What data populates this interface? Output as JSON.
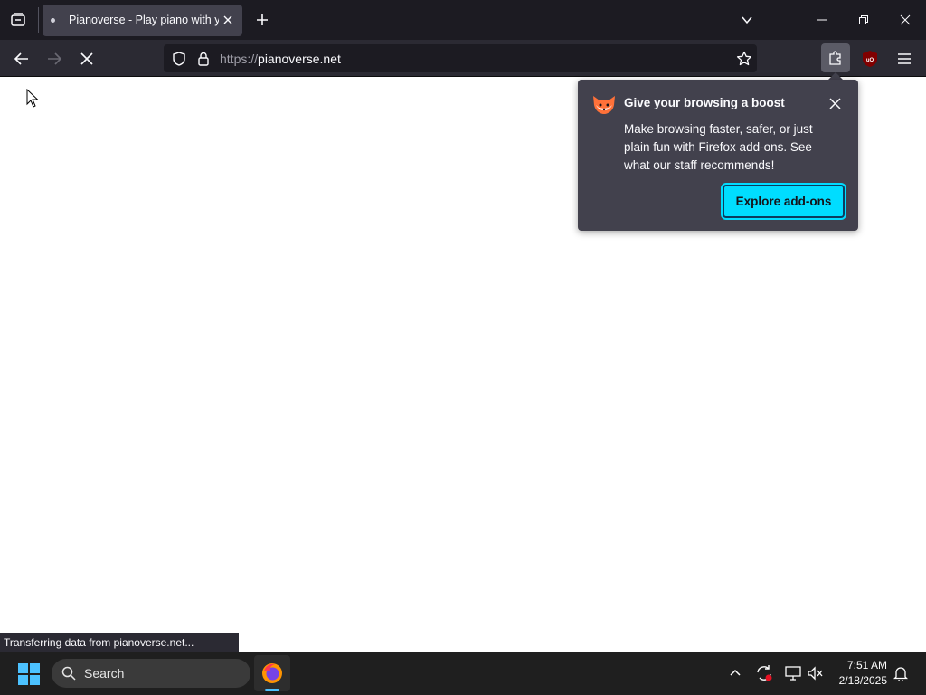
{
  "browser": {
    "tab": {
      "title": "Pianoverse - Play piano with yo"
    },
    "url": {
      "scheme": "https://",
      "host": "pianoverse.net"
    }
  },
  "popup": {
    "title": "Give your browsing a boost",
    "body": "Make browsing faster, safer, or just plain fun with Firefox add-ons. See what our staff recommends!",
    "button_label": "Explore add-ons"
  },
  "status_text": "Transferring data from pianoverse.net...",
  "taskbar": {
    "search_label": "Search",
    "time": "7:51 AM",
    "date": "2/18/2025"
  },
  "colors": {
    "accent": "#00ddff",
    "toolbar": "#2b2a33",
    "tabstrip": "#1c1b22",
    "ublock": "#800000"
  },
  "icons": [
    "tab-list-icon",
    "close-icon",
    "plus-icon",
    "chevron-down-icon",
    "minimize-icon",
    "restore-icon",
    "back-arrow-icon",
    "forward-arrow-icon",
    "stop-icon",
    "shield-icon",
    "lock-icon",
    "star-icon",
    "extensions-icon",
    "ublock-icon",
    "hamburger-menu-icon",
    "fox-icon",
    "windows-start-icon",
    "search-icon",
    "firefox-icon",
    "chevron-up-icon",
    "sync-icon",
    "network-icon",
    "muted-speaker-icon",
    "bell-icon",
    "mouse-pointer-icon"
  ]
}
